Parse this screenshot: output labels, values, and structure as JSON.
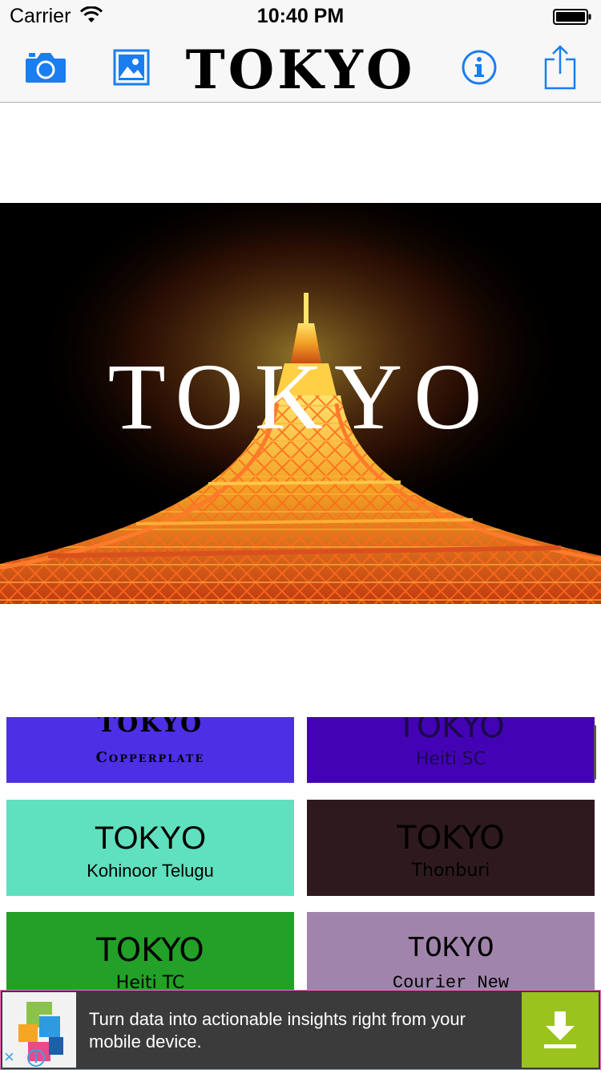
{
  "status_bar": {
    "carrier": "Carrier",
    "time": "10:40 PM"
  },
  "nav": {
    "title": "TOKYO",
    "icons": [
      "camera-icon",
      "photo-library-icon",
      "info-icon",
      "share-icon"
    ],
    "accent_color": "#1a7df0"
  },
  "photo": {
    "overlay_text": "TOKYO",
    "subject": "tokyo-tower-night"
  },
  "fonts": {
    "tiles": [
      {
        "word": "TOKYO",
        "font": "Copperplate",
        "bg": "#4d2fe6",
        "color": "#000000"
      },
      {
        "word": "TOKYO",
        "font": "Heiti SC",
        "bg": "#4303b5",
        "color": "#1b0a4a"
      },
      {
        "word": "TOKYO",
        "font": "Kohinoor Telugu",
        "bg": "#5fe0be",
        "color": "#000000"
      },
      {
        "word": "TOKYO",
        "font": "Thonburi",
        "bg": "#2e1a1e",
        "color": "#000000"
      },
      {
        "word": "TOKYO",
        "font": "Heiti TC",
        "bg": "#23a027",
        "color": "#000000"
      },
      {
        "word": "TOKYO",
        "font": "Courier New",
        "bg": "#a184ab",
        "color": "#000000"
      }
    ]
  },
  "ad": {
    "text": "Turn data into actionable insights right from your mobile device.",
    "close_label": "×",
    "download_color": "#9ac31e"
  }
}
